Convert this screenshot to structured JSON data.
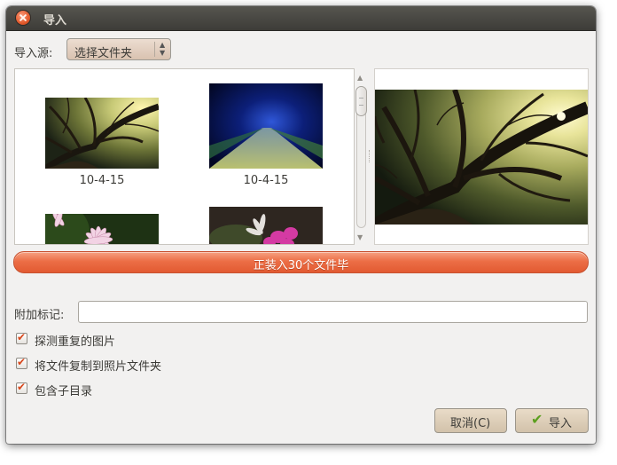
{
  "window": {
    "title": "导入"
  },
  "source": {
    "label": "导入源:",
    "selected": "选择文件夹"
  },
  "thumbnails": [
    {
      "caption": "10-4-15"
    },
    {
      "caption": "10-4-15"
    },
    {
      "caption": ""
    },
    {
      "caption": ""
    }
  ],
  "progress": {
    "text": "正装入30个文件毕",
    "fraction": 1.0
  },
  "tags": {
    "label": "附加标记:",
    "value": ""
  },
  "options": [
    {
      "label": "探测重复的图片",
      "checked": true
    },
    {
      "label": "将文件复制到照片文件夹",
      "checked": true
    },
    {
      "label": "包含子目录",
      "checked": true
    }
  ],
  "buttons": {
    "cancel": "取消(C)",
    "import": "导入"
  },
  "colors": {
    "accent": "#ea6a41",
    "titlebar": "#4a4944",
    "window_bg": "#f2f1f0"
  }
}
